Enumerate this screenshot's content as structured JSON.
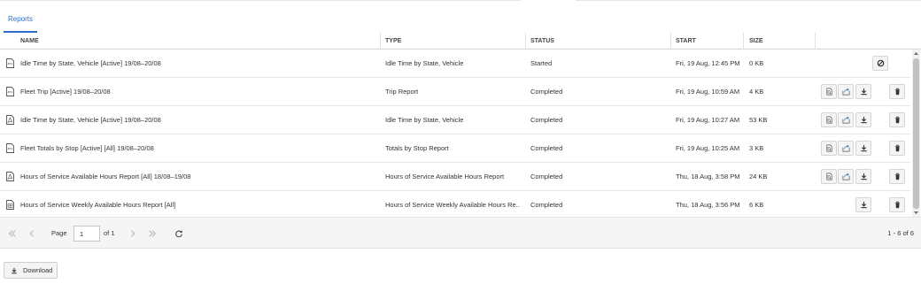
{
  "tabs": [
    {
      "label": "Reports"
    }
  ],
  "columns": {
    "name": "NAME",
    "type": "TYPE",
    "status": "STATUS",
    "start": "START",
    "size": "SIZE"
  },
  "rows": [
    {
      "icon": "document-icon",
      "name": "Idle Time by State, Vehicle [Active] 19/08–20/08",
      "type": "Idle Time by State, Vehicle",
      "status": "Started",
      "start": "Fri, 19 Aug, 12:45 PM",
      "size": "0 KB",
      "actions": [
        "cancel"
      ]
    },
    {
      "icon": "document-icon",
      "name": "Fleet Trip [Active] 19/08–20/08",
      "type": "Trip Report",
      "status": "Completed",
      "start": "Fri, 19 Aug, 10:59 AM",
      "size": "4 KB",
      "actions": [
        "preview",
        "export",
        "download",
        "delete"
      ]
    },
    {
      "icon": "pdf-icon",
      "name": "Idle Time by State, Vehicle [Active] 19/08–20/08",
      "type": "Idle Time by State, Vehicle",
      "status": "Completed",
      "start": "Fri, 19 Aug, 10:27 AM",
      "size": "53 KB",
      "actions": [
        "preview",
        "export",
        "download",
        "delete"
      ]
    },
    {
      "icon": "document-icon",
      "name": "Fleet Totals by Stop [Active] [All] 19/08–20/08",
      "type": "Totals by Stop Report",
      "status": "Completed",
      "start": "Fri, 19 Aug, 10:25 AM",
      "size": "3 KB",
      "actions": [
        "preview",
        "export",
        "download",
        "delete"
      ]
    },
    {
      "icon": "pdf-icon",
      "name": "Hours of Service Available Hours Report [All] 18/08–19/08",
      "type": "Hours of Service Available Hours Report",
      "status": "Completed",
      "start": "Thu, 18 Aug, 3:58 PM",
      "size": "24 KB",
      "actions": [
        "preview",
        "export",
        "download",
        "delete"
      ]
    },
    {
      "icon": "spreadsheet-icon",
      "name": "Hours of Service Weekly Available Hours Report [All]",
      "type": "Hours of Service Weekly Available Hours Re...",
      "status": "Completed",
      "start": "Thu, 18 Aug, 3:56 PM",
      "size": "6 KB",
      "actions": [
        "download",
        "delete"
      ]
    }
  ],
  "pager": {
    "page_label": "Page",
    "page_value": "1",
    "of_label": "of 1",
    "count": "1 - 6 of 6"
  },
  "footer": {
    "download_label": "Download"
  },
  "colors": {
    "accent": "#2e6bc6",
    "border": "#d5d5d5",
    "pager_bg": "#f5f5f5"
  }
}
